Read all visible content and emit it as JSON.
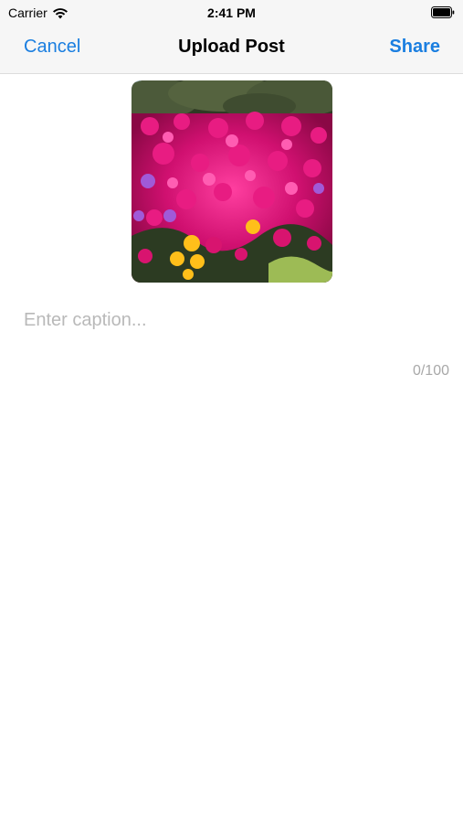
{
  "status_bar": {
    "carrier": "Carrier",
    "time": "2:41 PM",
    "wifi_icon": "wifi-icon",
    "battery_icon": "battery-icon"
  },
  "nav": {
    "cancel_label": "Cancel",
    "title": "Upload Post",
    "share_label": "Share",
    "accent_color": "#1a7ee0"
  },
  "photo": {
    "subject": "pink and purple ice plant flowers"
  },
  "caption": {
    "value": "",
    "placeholder": "Enter caption..."
  },
  "counter": {
    "text": "0/100"
  }
}
